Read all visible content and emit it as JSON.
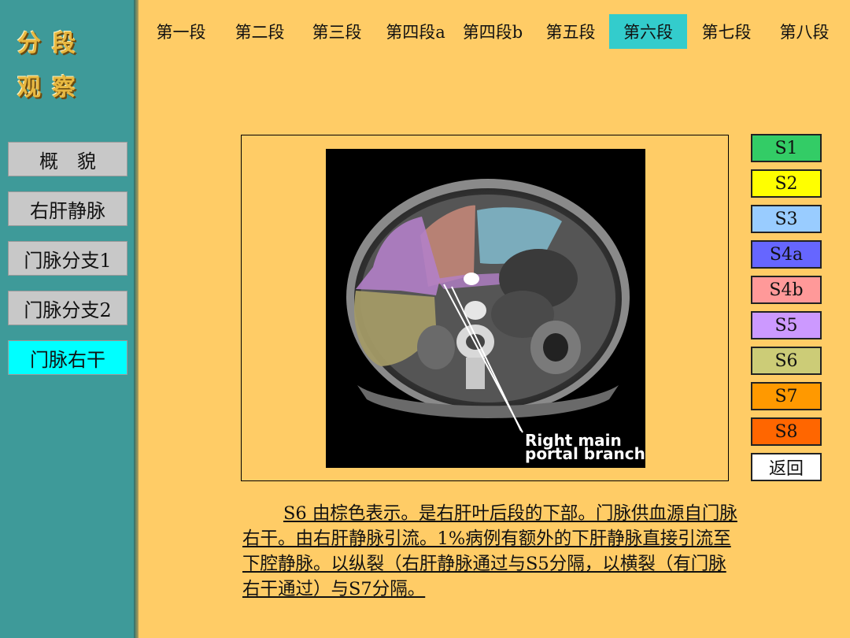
{
  "sidebar": {
    "logo_line1": "分段",
    "logo_line2": "观察",
    "items": [
      {
        "label": "概　貌"
      },
      {
        "label": "右肝静脉"
      },
      {
        "label": "门脉分支1"
      },
      {
        "label": "门脉分支2"
      },
      {
        "label": "门脉右干"
      }
    ]
  },
  "tabs": [
    {
      "label": "第一段"
    },
    {
      "label": "第二段"
    },
    {
      "label": "第三段"
    },
    {
      "label": "第四段a"
    },
    {
      "label": "第四段b"
    },
    {
      "label": "第五段"
    },
    {
      "label": "第六段"
    },
    {
      "label": "第七段"
    },
    {
      "label": "第八段"
    }
  ],
  "image": {
    "annotation_line1": "Right main",
    "annotation_line2": "portal branch"
  },
  "segment_buttons": [
    {
      "label": "S1",
      "color": "#33CC66"
    },
    {
      "label": "S2",
      "color": "#FFFF00"
    },
    {
      "label": "S3",
      "color": "#99CCFF"
    },
    {
      "label": "S4a",
      "color": "#6666FF"
    },
    {
      "label": "S4b",
      "color": "#FF9999"
    },
    {
      "label": "S5",
      "color": "#CC99FF"
    },
    {
      "label": "S6",
      "color": "#CCCC77"
    },
    {
      "label": "S7",
      "color": "#FF9900"
    },
    {
      "label": "S8",
      "color": "#FF6600"
    },
    {
      "label": "返回",
      "color": "#FFFFFF"
    }
  ],
  "description": "S6 由棕色表示。是右肝叶后段的下部。门脉供血源自门脉右干。由右肝静脉引流。1%病例有额外的下肝静脉直接引流至下腔静脉。以纵裂（右肝静脉通过与S5分隔，以横裂（有门脉右干通过）与S7分隔。",
  "colors": {
    "background": "#FFCC66",
    "sidebar": "#3E9A99",
    "active_tab": "#33CCCC",
    "active_sidebar_item": "#00FFFF"
  }
}
